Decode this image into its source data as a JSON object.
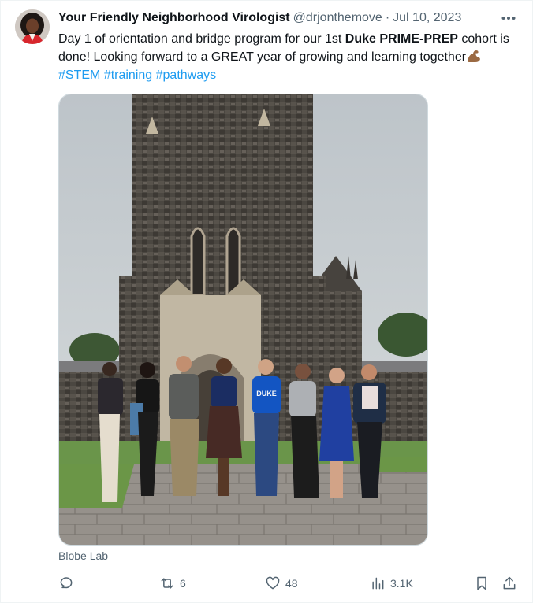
{
  "tweet": {
    "display_name": "Your Friendly Neighborhood Virologist",
    "handle": "@drjonthemove",
    "separator": "·",
    "date": "Jul 10, 2023",
    "text_part1": "Day 1 of orientation and bridge program for our 1st ",
    "text_bold": "Duke PRIME-PREP",
    "text_part2": " cohort is done! Looking forward to a GREAT year of growing and learning together",
    "emoji_name": "flexed-biceps-emoji",
    "hashtags": [
      "#STEM",
      "#training",
      "#pathways"
    ],
    "media_caption": "Blobe Lab",
    "photo_shirt_text": "DUKE"
  },
  "actions": {
    "reply_count": "",
    "retweet_count": "6",
    "like_count": "48",
    "views_count": "3.1K"
  },
  "icons": {
    "more": "more-icon",
    "reply": "reply-icon",
    "retweet": "retweet-icon",
    "like": "heart-icon",
    "views": "views-icon",
    "bookmark": "bookmark-icon",
    "share": "share-icon"
  },
  "colors": {
    "text": "#0f1419",
    "secondary": "#536471",
    "link": "#1d9bf0"
  }
}
